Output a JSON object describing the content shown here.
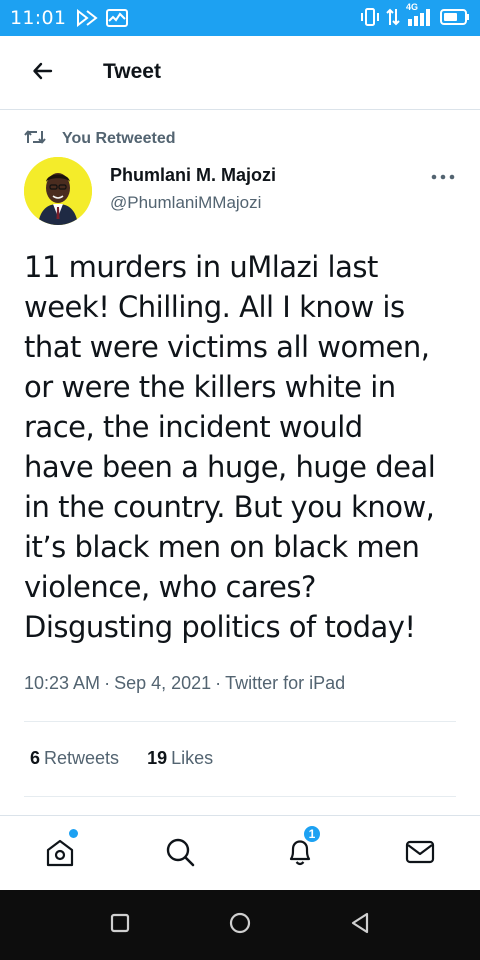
{
  "status_bar": {
    "time": "11:01",
    "network_label": "4G",
    "background_color": "#1da1f2"
  },
  "header": {
    "back_icon": "arrow-left-icon",
    "title": "Tweet"
  },
  "retweet_indicator": {
    "icon": "retweet-icon",
    "label": "You Retweeted"
  },
  "author": {
    "display_name": "Phumlani M. Majozi",
    "handle": "@PhumlaniMMajozi",
    "avatar_background": "#f4ec2a"
  },
  "tweet": {
    "lines": [
      "11 murders in uMlazi last",
      "week! Chilling. All I know is",
      "that were victims all women,",
      "or were the killers white in",
      "race, the incident would",
      "have been a huge, huge deal",
      "in the country. But you know,",
      "it’s black men on black men",
      "violence, who cares?",
      "Disgusting politics of today!"
    ],
    "time": "10:23 AM",
    "date": "Sep 4, 2021",
    "source": "Twitter for iPad",
    "separator": "·"
  },
  "stats": {
    "retweets_count": "6",
    "retweets_label": "Retweets",
    "likes_count": "19",
    "likes_label": "Likes"
  },
  "bottom_nav": {
    "items": [
      {
        "icon": "home-icon",
        "has_dot": true
      },
      {
        "icon": "search-icon"
      },
      {
        "icon": "bell-icon",
        "badge": "1"
      },
      {
        "icon": "mail-icon"
      }
    ],
    "notification_badge": "1",
    "accent_color": "#1da1f2"
  },
  "android_nav": {
    "items": [
      "recent-apps-icon",
      "home-circle-icon",
      "back-triangle-icon"
    ]
  }
}
